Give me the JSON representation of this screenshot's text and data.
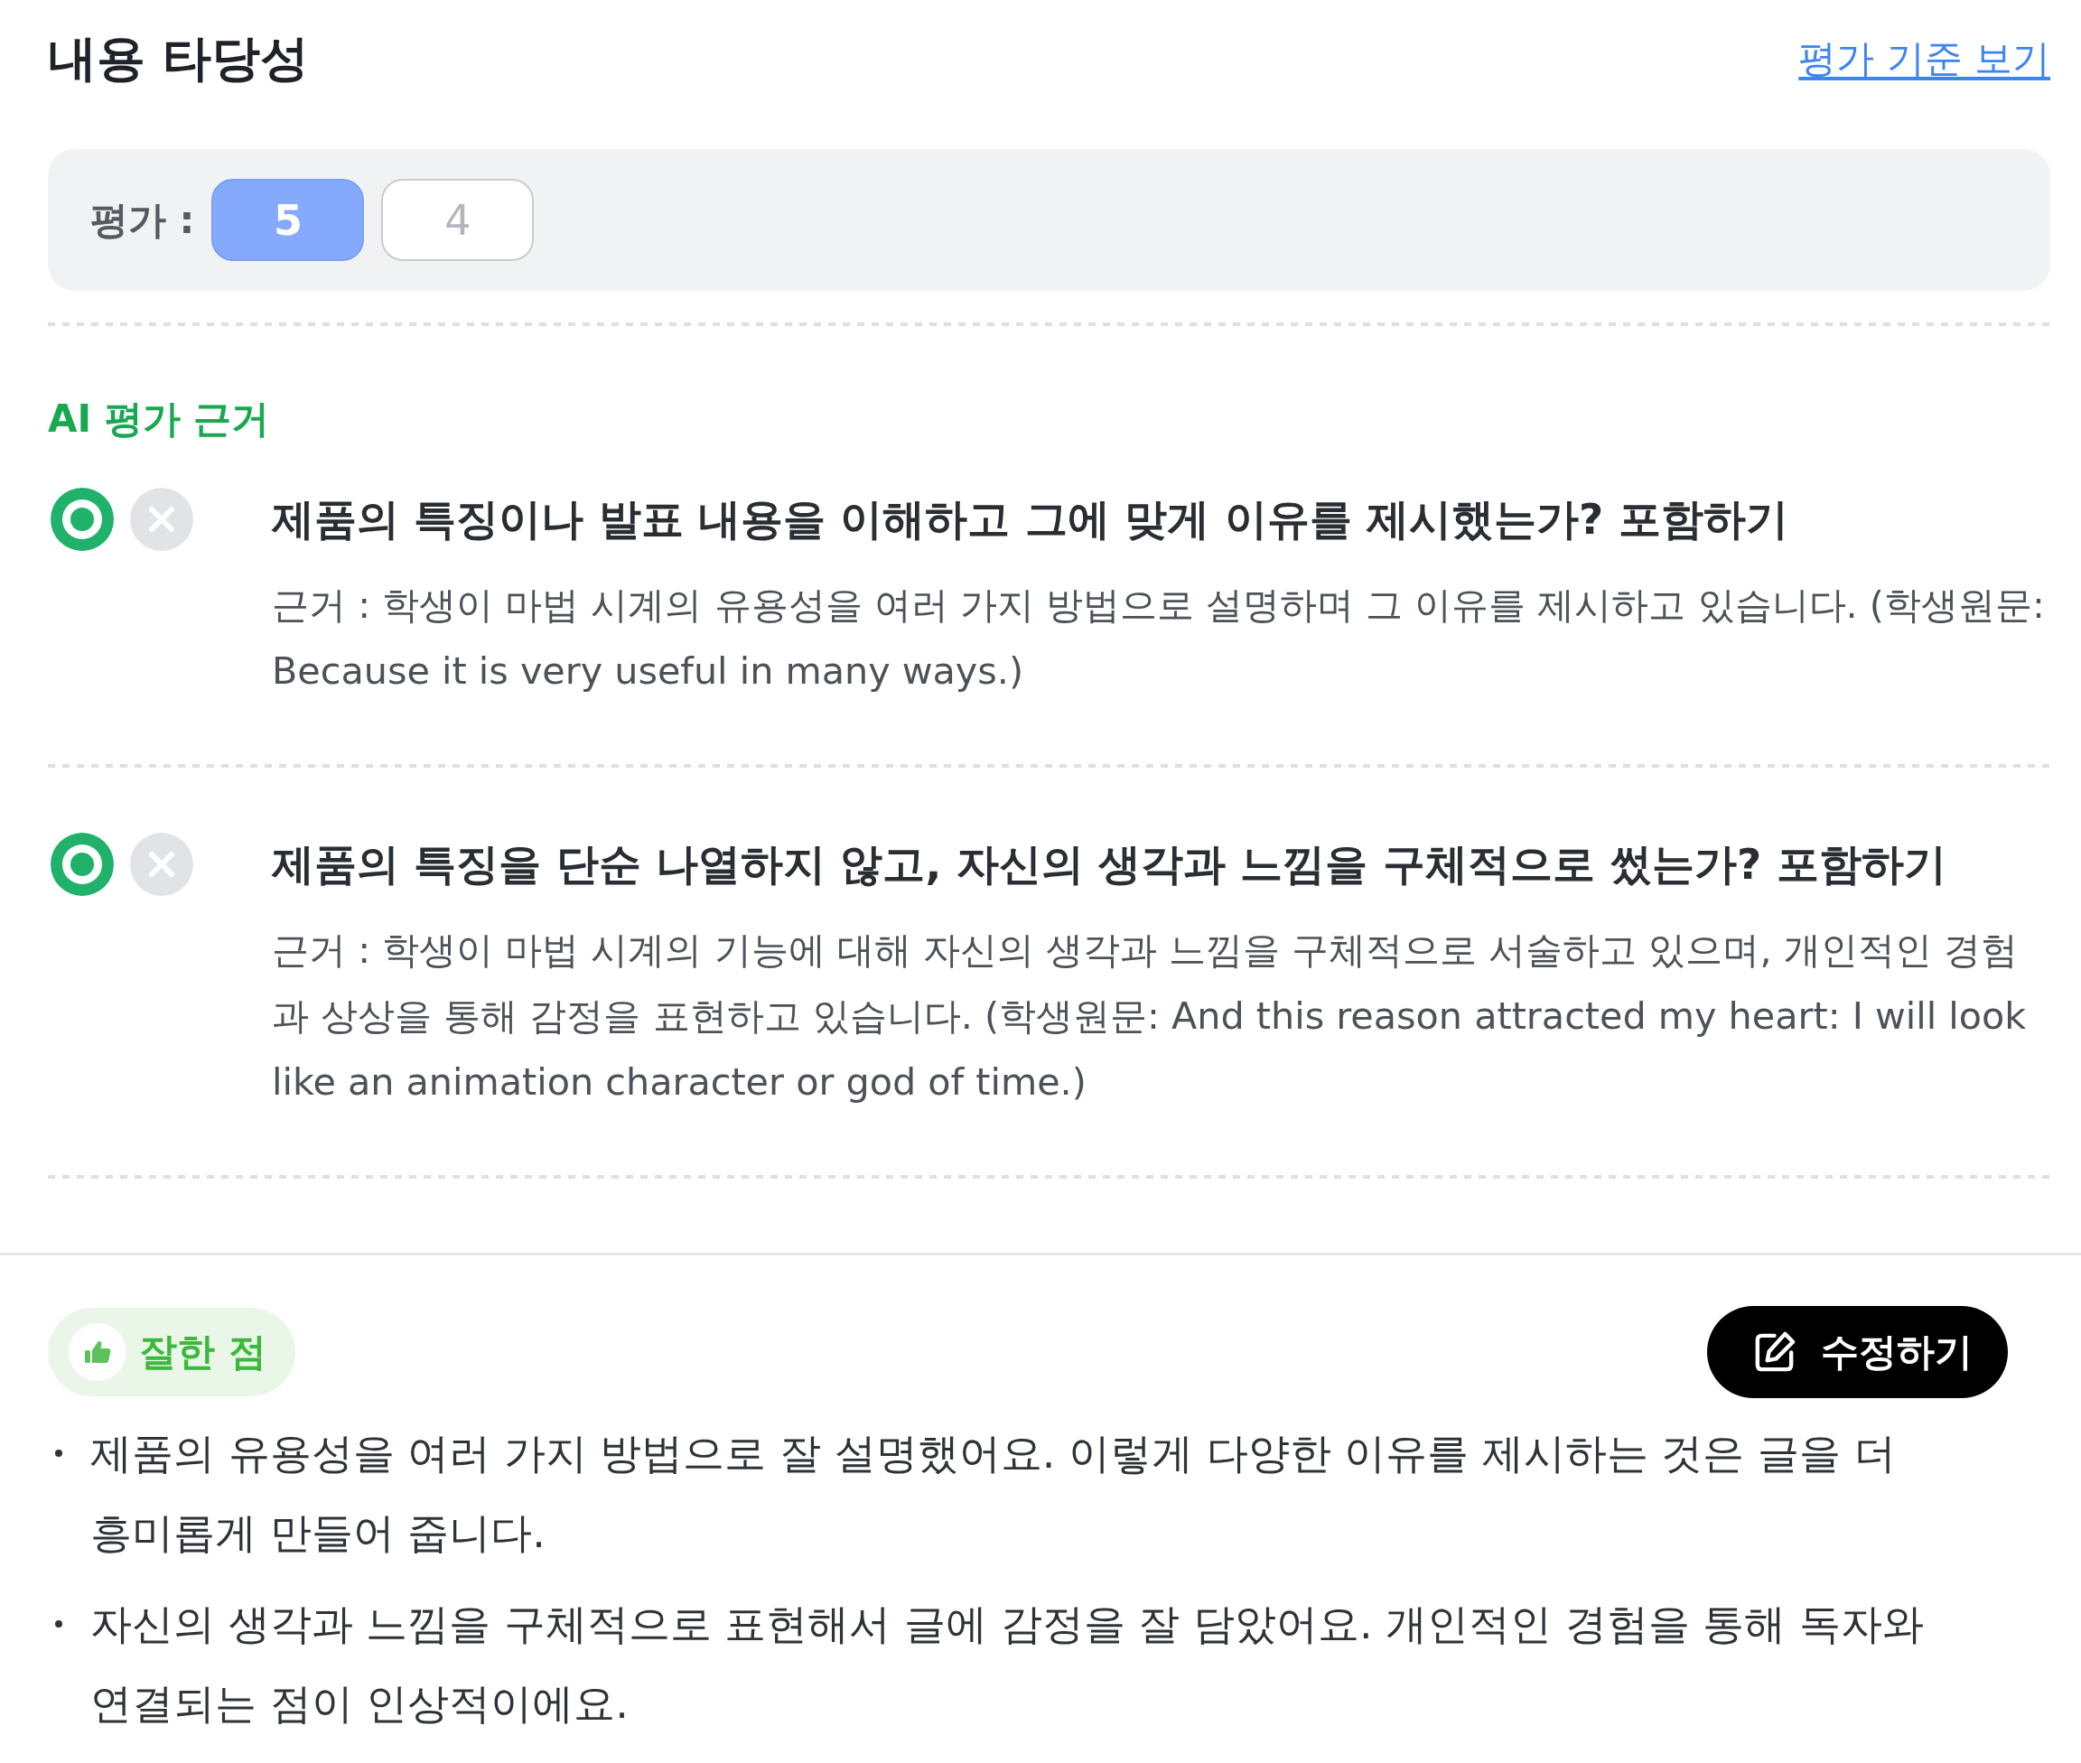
{
  "header": {
    "title": "내용 타당성",
    "link": "평가 기준 보기"
  },
  "rating": {
    "label": "평가 :",
    "options": [
      {
        "label": "5",
        "selected": true
      },
      {
        "label": "4",
        "selected": false
      }
    ]
  },
  "ai_rationale": {
    "heading": "AI 평가 근거",
    "criteria": [
      {
        "passed": true,
        "title": "제품의 특징이나 발표 내용을 이해하고 그에 맞게 이유를 제시했는가? 포함하기",
        "rationale": "근거 : 학생이 마법 시계의 유용성을 여러 가지 방법으로 설명하며 그 이유를 제시하고 있습니다. (학생원문: Because it is very useful in many ways.)"
      },
      {
        "passed": true,
        "title": "제품의 특징을 단순 나열하지 않고, 자신의 생각과 느낌을 구체적으로 썼는가? 포함하기",
        "rationale": "근거 : 학생이 마법 시계의 기능에 대해 자신의 생각과 느낌을 구체적으로 서술하고 있으며, 개인적인 경험과 상상을 통해 감정을 표현하고 있습니다. (학생원문: And this reason attracted my heart: I will look like an animation character or god of time.)"
      }
    ]
  },
  "strengths": {
    "badge": "잘한 점",
    "edit_button": "수정하기",
    "items": [
      "제품의 유용성을 여러 가지 방법으로 잘 설명했어요. 이렇게 다양한 이유를 제시하는 것은 글을 더 흥미롭게 만들어 줍니다.",
      "자신의 생각과 느낌을 구체적으로 표현해서 글에 감정을 잘 담았어요. 개인적인 경험을 통해 독자와 연결되는 점이 인상적이에요."
    ]
  }
}
